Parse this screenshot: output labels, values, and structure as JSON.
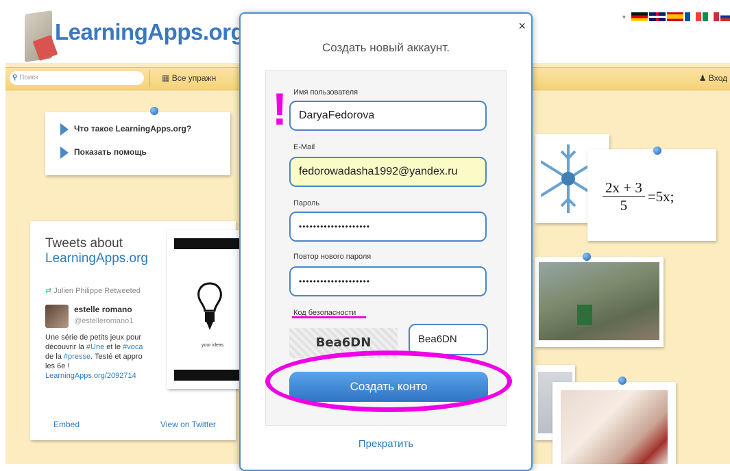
{
  "site": {
    "logo_text": "LearningApps.org"
  },
  "nav": {
    "search_placeholder": "Поиск",
    "exercises_label": "Все упражн",
    "login_label": "Вход"
  },
  "help_box": {
    "items": [
      "Что такое LearningApps.org?",
      "Показать помощь"
    ]
  },
  "tweets": {
    "title_line1": "Tweets about",
    "title_line2": "LearningApps.org",
    "retweeted": "Julien Philippe Retweeted",
    "author_name": "estelle romano",
    "author_handle": "@estelleromano1",
    "text_parts": [
      "Une série de petits jeux pour",
      "découvrir la ",
      "#Une",
      " et le ",
      "#voca",
      "de la ",
      "#presse",
      ". Testé et appro",
      "les 6e !",
      "LearningApps.org/2092714"
    ],
    "embed_label": "Embed",
    "view_label": "View on Twitter"
  },
  "bulb_card": {
    "caption": "your ideas"
  },
  "math_card": {
    "numerator": "2x + 3",
    "denominator": "5",
    "rhs": "=5x;"
  },
  "modal": {
    "close": "×",
    "title": "Создать новый аккаунт.",
    "username_label": "Имя пользователя",
    "username_value": "DaryaFedorova",
    "email_label": "E-Mail",
    "email_value": "fedorowadasha1992@yandex.ru",
    "password_label": "Пароль",
    "password_value": "••••••••••••••••••••",
    "password_repeat_label": "Повтор нового пароля",
    "password_repeat_value": "••••••••••••••••••••",
    "captcha_label": "Код безопасности",
    "captcha_image_text": "Bea6DN",
    "captcha_value": "Bea6DN",
    "submit_label": "Создать конто",
    "cancel_label": "Прекратить"
  },
  "annotations": {
    "mark": "!",
    "color": "#f000e6"
  },
  "colors": {
    "background": "#fcecc0",
    "accent": "#3a78c2",
    "field_border": "#4a86c8"
  }
}
